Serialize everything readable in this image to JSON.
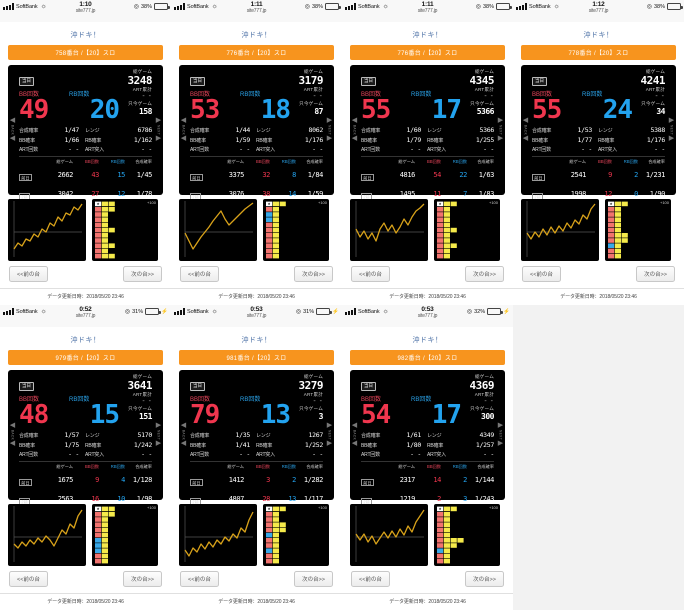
{
  "site": {
    "host": "site777.jp",
    "carrier": "SoftBank",
    "page_title": "沖ドキ！"
  },
  "labels": {
    "bb_count": "BB回数",
    "rb_count": "RB回数",
    "total_game": "総ゲーム",
    "art_total": "ART累計",
    "current_game": "只今ゲーム",
    "combined_rate": "合成確率",
    "range": "レンジ",
    "bb_rate": "BB確率",
    "rb_rate": "RB確率",
    "art_count": "ART回数",
    "art_entry": "ART突入",
    "today_badge": "当日",
    "prev1": "前日",
    "prev2": "2前",
    "dash": "- -",
    "plus100": "+100",
    "prev_machine": "<<前の台",
    "next_machine": "次の台>>",
    "back_vertical": "BACK",
    "next_vertical": "NEXT",
    "updated_prefix": "データ更新日時：",
    "updated_value": "2018/05/20 23:46"
  },
  "colors": {
    "accent_orange": "#f7941e",
    "bb_red": "#f0364e",
    "rb_blue": "#23a3ef",
    "chart_line": "#d8a21a",
    "block_yellow": "#f5ea4a",
    "block_red": "#f2736f",
    "block_blue": "#38a8e8",
    "title_blue": "#4a6fa5"
  },
  "screens": [
    {
      "status": {
        "time": "1:10",
        "battery": "38%",
        "battery_pct": 38,
        "battery_color": "#111111",
        "charging": false
      },
      "machine_button": "758番台 /【20】スロ",
      "bb": "49",
      "rb": "20",
      "total_game": "3248",
      "art_total": "- -",
      "current_game": "158",
      "combined_rate": "1/47",
      "range": "6786",
      "bb_rate": "1/66",
      "rb_rate": "1/162",
      "art_count": "- -",
      "art_entry": "- -",
      "history": [
        {
          "tag": "前日",
          "games": "2662",
          "bb": "43",
          "rb": "15",
          "rate": "1/45"
        },
        {
          "tag": "2前",
          "games": "3042",
          "bb": "27",
          "rb": "12",
          "rate": "1/78"
        }
      ],
      "line_points": "6,50 10,44 14,47 18,40 22,42 26,35 30,38 34,30 38,33 42,24 46,27 50,18 54,22 58,14 62,16 66,8 70,11 74,5",
      "blocks": [
        {
          "left": "red",
          "bars": [
            2
          ]
        },
        {
          "left": "red",
          "bars": [
            1
          ]
        },
        {
          "left": "red",
          "bars": [
            1
          ]
        },
        {
          "left": "red",
          "bars": [
            1
          ]
        },
        {
          "left": "red",
          "bars": [
            2
          ]
        },
        {
          "left": "red",
          "bars": [
            1
          ]
        },
        {
          "left": "red",
          "bars": [
            1
          ]
        },
        {
          "left": "red",
          "bars": [
            2
          ]
        },
        {
          "left": "red",
          "bars": [
            1
          ]
        },
        {
          "left": "red",
          "bars": [
            2
          ]
        }
      ]
    },
    {
      "status": {
        "time": "1:11",
        "battery": "38%",
        "battery_pct": 38,
        "battery_color": "#111111",
        "charging": false
      },
      "machine_button": "776番台 /【20】スロ",
      "bb": "53",
      "rb": "18",
      "total_game": "3179",
      "art_total": "- -",
      "current_game": "87",
      "combined_rate": "1/44",
      "range": "8062",
      "bb_rate": "1/59",
      "rb_rate": "1/176",
      "art_count": "- -",
      "art_entry": "- -",
      "history": [
        {
          "tag": "前日",
          "games": "3375",
          "bb": "32",
          "rb": "8",
          "rate": "1/84"
        },
        {
          "tag": "2前",
          "games": "3076",
          "bb": "38",
          "rb": "14",
          "rate": "1/59"
        }
      ],
      "line_points": "6,34 10,42 14,50 18,44 22,38 26,33 30,28 34,22 38,17 42,12 46,20 50,26 54,22 58,18 62,14 66,10 70,7 74,4",
      "blocks": [
        {
          "left": "red",
          "bars": [
            1
          ]
        },
        {
          "left": "blue",
          "bars": [
            1
          ]
        },
        {
          "left": "blue",
          "bars": [
            1
          ]
        },
        {
          "left": "red",
          "bars": [
            1
          ]
        },
        {
          "left": "red",
          "bars": [
            1
          ]
        },
        {
          "left": "red",
          "bars": [
            1
          ]
        },
        {
          "left": "red",
          "bars": [
            1
          ]
        },
        {
          "left": "red",
          "bars": [
            1
          ]
        },
        {
          "left": "red",
          "bars": [
            1
          ]
        },
        {
          "left": "red",
          "bars": [
            1
          ]
        }
      ]
    },
    {
      "status": {
        "time": "1:11",
        "battery": "38%",
        "battery_pct": 38,
        "battery_color": "#111111",
        "charging": false
      },
      "machine_button": "776番台 /【20】スロ",
      "bb": "55",
      "rb": "17",
      "total_game": "4345",
      "art_total": "- -",
      "current_game": "5366",
      "combined_rate": "1/60",
      "range": "5366",
      "bb_rate": "1/79",
      "rb_rate": "1/255",
      "art_count": "- -",
      "art_entry": "- -",
      "history": [
        {
          "tag": "前日",
          "games": "4816",
          "bb": "54",
          "rb": "22",
          "rate": "1/63"
        },
        {
          "tag": "2前",
          "games": "1495",
          "bb": "11",
          "rb": "7",
          "rate": "1/83"
        }
      ],
      "line_points": "6,30 10,38 14,32 18,40 22,34 26,42 30,30 34,24 38,32 42,26 46,34 50,28 54,20 58,26 62,18 66,12 70,9 74,5",
      "blocks": [
        {
          "left": "red",
          "bars": [
            1
          ]
        },
        {
          "left": "red",
          "bars": [
            1
          ]
        },
        {
          "left": "red",
          "bars": [
            1
          ]
        },
        {
          "left": "red",
          "bars": [
            1
          ]
        },
        {
          "left": "red",
          "bars": [
            2
          ]
        },
        {
          "left": "red",
          "bars": [
            1
          ]
        },
        {
          "left": "red",
          "bars": [
            1
          ]
        },
        {
          "left": "red",
          "bars": [
            2
          ]
        },
        {
          "left": "red",
          "bars": [
            1
          ]
        },
        {
          "left": "red",
          "bars": [
            1
          ]
        }
      ]
    },
    {
      "status": {
        "time": "1:12",
        "battery": "38%",
        "battery_pct": 38,
        "battery_color": "#111111",
        "charging": false
      },
      "machine_button": "778番台 /【20】スロ",
      "bb": "55",
      "rb": "24",
      "total_game": "4241",
      "art_total": "- -",
      "current_game": "34",
      "combined_rate": "1/53",
      "range": "5388",
      "bb_rate": "1/77",
      "rb_rate": "1/176",
      "art_count": "- -",
      "art_entry": "- -",
      "history": [
        {
          "tag": "前日",
          "games": "2541",
          "bb": "9",
          "rb": "2",
          "rate": "1/231"
        },
        {
          "tag": "2前",
          "games": "1998",
          "bb": "12",
          "rb": "0",
          "rate": "1/90"
        }
      ],
      "line_points": "6,34 10,40 14,33 18,38 22,30 26,36 30,28 34,34 38,27 42,32 46,24 50,29 54,21 58,25 62,16 66,20 70,10 74,5",
      "blocks": [
        {
          "left": "red",
          "bars": [
            1
          ]
        },
        {
          "left": "red",
          "bars": [
            1
          ]
        },
        {
          "left": "red",
          "bars": [
            1
          ]
        },
        {
          "left": "red",
          "bars": [
            1
          ]
        },
        {
          "left": "red",
          "bars": [
            1
          ]
        },
        {
          "left": "red",
          "bars": [
            2
          ]
        },
        {
          "left": "red",
          "bars": [
            2
          ]
        },
        {
          "left": "blue",
          "bars": [
            1
          ]
        },
        {
          "left": "red",
          "bars": [
            1
          ]
        },
        {
          "left": "red",
          "bars": [
            1
          ]
        }
      ]
    },
    {
      "status": {
        "time": "0:52",
        "battery": "31%",
        "battery_pct": 31,
        "battery_color": "#4cd964",
        "charging": true
      },
      "machine_button": "979番台 /【20】スロ",
      "bb": "48",
      "rb": "15",
      "total_game": "3641",
      "art_total": "- -",
      "current_game": "151",
      "combined_rate": "1/57",
      "range": "5170",
      "bb_rate": "1/75",
      "rb_rate": "1/242",
      "art_count": "- -",
      "art_entry": "- -",
      "history": [
        {
          "tag": "前日",
          "games": "1675",
          "bb": "9",
          "rb": "4",
          "rate": "1/128"
        },
        {
          "tag": "2前",
          "games": "2563",
          "bb": "16",
          "rb": "10",
          "rate": "1/98"
        }
      ],
      "line_points": "6,40 10,44 14,38 18,42 22,36 26,40 30,34 34,38 38,32 42,36 46,42 50,34 54,26 58,30 62,20 66,24 70,12 74,6",
      "blocks": [
        {
          "left": "red",
          "bars": [
            2
          ]
        },
        {
          "left": "red",
          "bars": [
            1
          ]
        },
        {
          "left": "red",
          "bars": [
            1
          ]
        },
        {
          "left": "red",
          "bars": [
            1
          ]
        },
        {
          "left": "red",
          "bars": [
            1
          ]
        },
        {
          "left": "blue",
          "bars": [
            1
          ]
        },
        {
          "left": "blue",
          "bars": [
            1
          ]
        },
        {
          "left": "blue",
          "bars": [
            1
          ]
        },
        {
          "left": "red",
          "bars": [
            1
          ]
        },
        {
          "left": "red",
          "bars": [
            1
          ]
        }
      ]
    },
    {
      "status": {
        "time": "0:53",
        "battery": "31%",
        "battery_pct": 31,
        "battery_color": "#4cd964",
        "charging": true
      },
      "machine_button": "981番台 /【20】スロ",
      "bb": "79",
      "rb": "13",
      "total_game": "3279",
      "art_total": "- -",
      "current_game": "3",
      "combined_rate": "1/35",
      "range": "1267",
      "bb_rate": "1/41",
      "rb_rate": "1/252",
      "art_count": "- -",
      "art_entry": "- -",
      "history": [
        {
          "tag": "前日",
          "games": "1412",
          "bb": "3",
          "rb": "2",
          "rate": "1/282"
        },
        {
          "tag": "2前",
          "games": "4807",
          "bb": "28",
          "rb": "13",
          "rate": "1/117"
        }
      ],
      "line_points": "6,46 10,52 14,44 18,48 22,40 26,45 30,38 34,43 38,36 42,40 46,33 50,37 54,30 58,34 62,24 66,28 70,16 74,8",
      "blocks": [
        {
          "left": "red",
          "bars": [
            1
          ]
        },
        {
          "left": "red",
          "bars": [
            1
          ]
        },
        {
          "left": "red",
          "bars": [
            2
          ]
        },
        {
          "left": "red",
          "bars": [
            2
          ]
        },
        {
          "left": "blue",
          "bars": [
            1
          ]
        },
        {
          "left": "red",
          "bars": [
            1
          ]
        },
        {
          "left": "red",
          "bars": [
            1
          ]
        },
        {
          "left": "blue",
          "bars": [
            1
          ]
        },
        {
          "left": "red",
          "bars": [
            1
          ]
        },
        {
          "left": "red",
          "bars": [
            1
          ]
        }
      ]
    },
    {
      "status": {
        "time": "0:53",
        "battery": "32%",
        "battery_pct": 32,
        "battery_color": "#4cd964",
        "charging": true
      },
      "machine_button": "982番台 /【20】スロ",
      "bb": "54",
      "rb": "17",
      "total_game": "4369",
      "art_total": "- -",
      "current_game": "300",
      "combined_rate": "1/61",
      "range": "4349",
      "bb_rate": "1/80",
      "rb_rate": "1/257",
      "art_count": "- -",
      "art_entry": "- -",
      "history": [
        {
          "tag": "前日",
          "games": "2317",
          "bb": "14",
          "rb": "2",
          "rate": "1/144"
        },
        {
          "tag": "2前",
          "games": "1219",
          "bb": "2",
          "rb": "3",
          "rate": "1/243"
        }
      ],
      "line_points": "6,30 10,36 14,30 18,38 22,32 26,40 30,34 34,28 38,34 42,27 46,33 50,25 54,31 58,22 62,28 66,18 70,12 74,6",
      "blocks": [
        {
          "left": "red",
          "bars": [
            1
          ]
        },
        {
          "left": "red",
          "bars": [
            1
          ]
        },
        {
          "left": "red",
          "bars": [
            1
          ]
        },
        {
          "left": "red",
          "bars": [
            1
          ]
        },
        {
          "left": "red",
          "bars": [
            1
          ]
        },
        {
          "left": "red",
          "bars": [
            3
          ]
        },
        {
          "left": "red",
          "bars": [
            2
          ]
        },
        {
          "left": "blue",
          "bars": [
            1
          ]
        },
        {
          "left": "red",
          "bars": [
            1
          ]
        },
        {
          "left": "red",
          "bars": [
            1
          ]
        }
      ]
    }
  ]
}
